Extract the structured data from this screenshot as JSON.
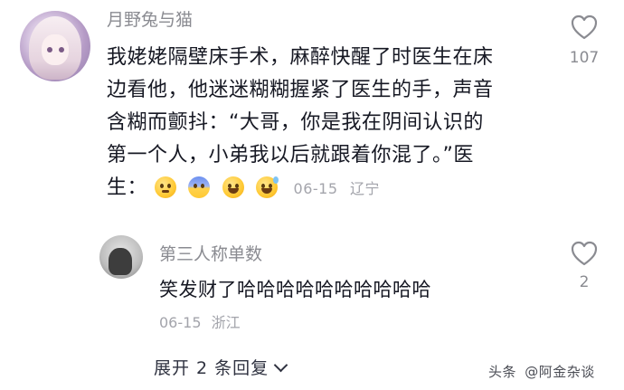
{
  "comment": {
    "username": "月野兔与猫",
    "lines": [
      "我姥姥隔壁床手术，麻醉快醒了时医生在床",
      "边看他，他迷迷糊糊握紧了医生的手，声音",
      "含糊而颤抖：“大哥，你是我在阴间认识的",
      "第一个人，小弟我以后就跟着你混了。”医",
      "生："
    ],
    "emojis": [
      "cry-emoji",
      "fear-emoji",
      "grin-emoji",
      "sweat-emoji"
    ],
    "date": "06-15",
    "location": "辽宁",
    "like_count": "107"
  },
  "reply": {
    "username": "第三人称单数",
    "text": "笑发财了哈哈哈哈哈哈哈哈哈哈",
    "date": "06-15",
    "location": "浙江",
    "like_count": "2"
  },
  "expand_label": "展开 2 条回复",
  "watermark": {
    "source": "头条",
    "account": "@阿金杂谈"
  }
}
